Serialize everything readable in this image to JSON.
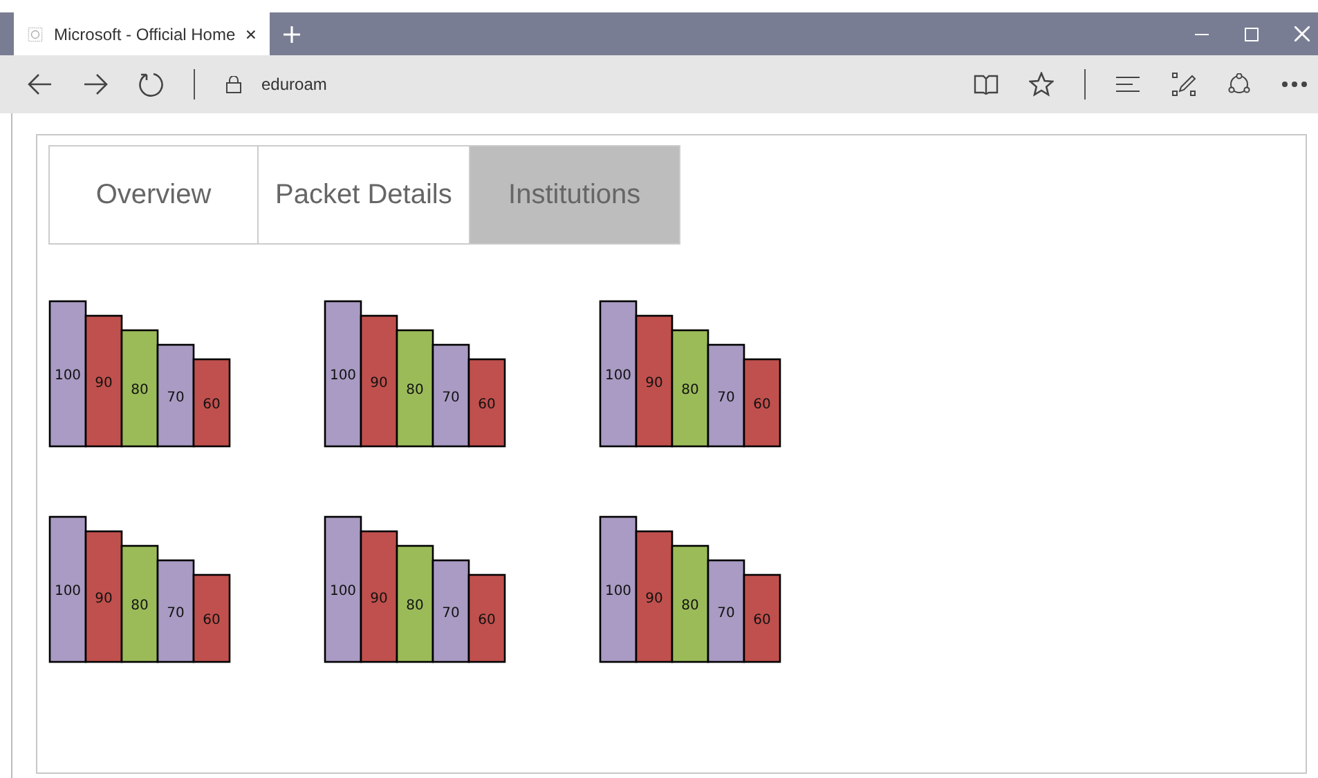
{
  "browser": {
    "tab_title": "Microsoft  - Official Home",
    "address": "eduroam"
  },
  "tabs": [
    {
      "label": "Overview",
      "selected": false
    },
    {
      "label": "Packet Details",
      "selected": false
    },
    {
      "label": "Institutions",
      "selected": true
    }
  ],
  "charts": [
    {
      "chart_data": {
        "type": "bar",
        "values": [
          100,
          90,
          80,
          70,
          60
        ],
        "colors": [
          "#a99bc3",
          "#c0504d",
          "#9bbb59",
          "#a99bc3",
          "#c0504d"
        ],
        "data_labels": true
      }
    },
    {
      "chart_data": {
        "type": "bar",
        "values": [
          100,
          90,
          80,
          70,
          60
        ],
        "colors": [
          "#a99bc3",
          "#c0504d",
          "#9bbb59",
          "#a99bc3",
          "#c0504d"
        ],
        "data_labels": true
      }
    },
    {
      "chart_data": {
        "type": "bar",
        "values": [
          100,
          90,
          80,
          70,
          60
        ],
        "colors": [
          "#a99bc3",
          "#c0504d",
          "#9bbb59",
          "#a99bc3",
          "#c0504d"
        ],
        "data_labels": true
      }
    },
    {
      "chart_data": {
        "type": "bar",
        "values": [
          100,
          90,
          80,
          70,
          60
        ],
        "colors": [
          "#a99bc3",
          "#c0504d",
          "#9bbb59",
          "#a99bc3",
          "#c0504d"
        ],
        "data_labels": true
      }
    },
    {
      "chart_data": {
        "type": "bar",
        "values": [
          100,
          90,
          80,
          70,
          60
        ],
        "colors": [
          "#a99bc3",
          "#c0504d",
          "#9bbb59",
          "#a99bc3",
          "#c0504d"
        ],
        "data_labels": true
      }
    },
    {
      "chart_data": {
        "type": "bar",
        "values": [
          100,
          90,
          80,
          70,
          60
        ],
        "colors": [
          "#a99bc3",
          "#c0504d",
          "#9bbb59",
          "#a99bc3",
          "#c0504d"
        ],
        "data_labels": true
      }
    }
  ]
}
